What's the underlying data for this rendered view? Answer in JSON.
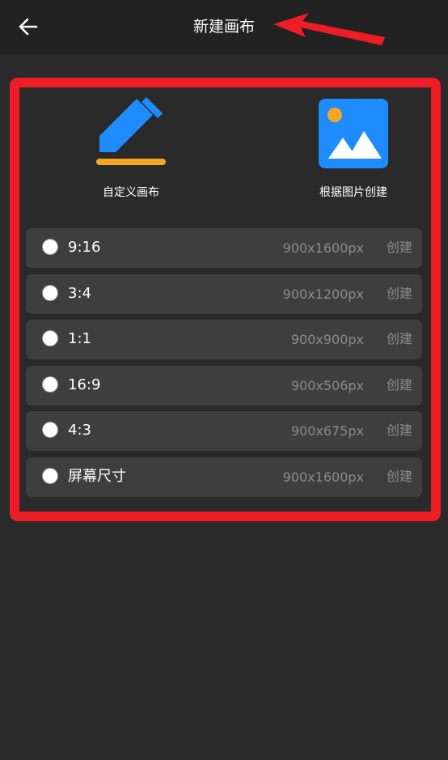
{
  "header": {
    "title": "新建画布",
    "back_icon": "arrow-left-icon"
  },
  "annotation": {
    "color": "#ee1c24"
  },
  "options": [
    {
      "label": "自定义画布",
      "icon": "pencil-icon"
    },
    {
      "label": "根据图片创建",
      "icon": "image-icon"
    }
  ],
  "ratios": [
    {
      "name": "9:16",
      "size": "900x1600px",
      "action": "创建"
    },
    {
      "name": "3:4",
      "size": "900x1200px",
      "action": "创建"
    },
    {
      "name": "1:1",
      "size": "900x900px",
      "action": "创建"
    },
    {
      "name": "16:9",
      "size": "900x506px",
      "action": "创建"
    },
    {
      "name": "4:3",
      "size": "900x675px",
      "action": "创建"
    },
    {
      "name": "屏幕尺寸",
      "size": "900x1600px",
      "action": "创建"
    }
  ],
  "colors": {
    "background": "#2a2a2a",
    "header": "#222222",
    "row": "#3e3e3e",
    "accent_blue": "#1e8bff",
    "accent_orange": "#f5a623"
  }
}
